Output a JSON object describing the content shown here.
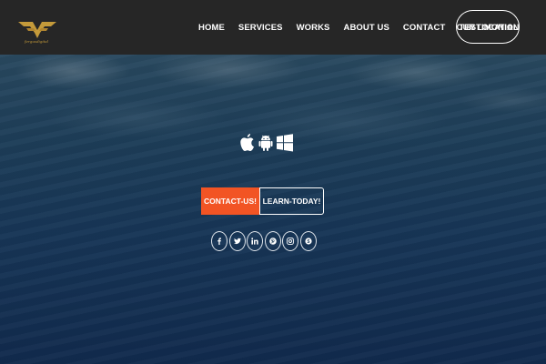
{
  "brand": {
    "logo_text": "fergusdigital",
    "logo_color": "#c49a3a"
  },
  "nav": {
    "items": [
      "HOME",
      "SERVICES",
      "WORKS",
      "ABOUT US",
      "CONTACT",
      "TESTIMONIAL"
    ],
    "location_button": "OUR LOCATION",
    "background": "#262626"
  },
  "hero": {
    "platform_icons": [
      "apple-icon",
      "android-icon",
      "windows-icon"
    ],
    "primary_button": "CONTACT-US!",
    "secondary_button": "LEARN-TODAY!",
    "accent_color": "#f25424",
    "social_icons": [
      "facebook-icon",
      "twitter-icon",
      "linkedin-icon",
      "pinterest-icon",
      "instagram-icon",
      "skype-icon"
    ]
  }
}
